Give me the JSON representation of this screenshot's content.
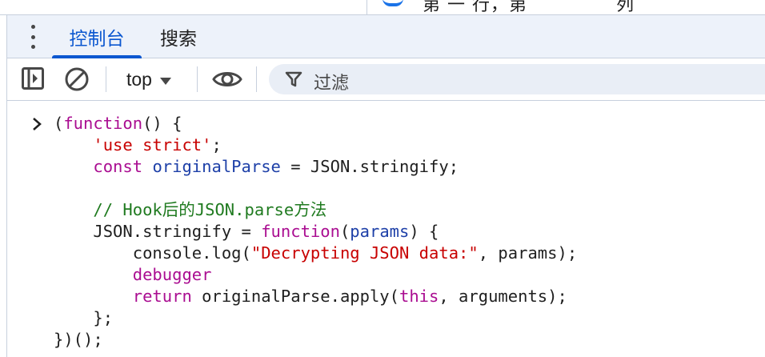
{
  "top_strip": {
    "fragment_left": "第 一 行，第",
    "fragment_right": "列"
  },
  "tabs": [
    {
      "label": "控制台",
      "active": true
    },
    {
      "label": "搜索",
      "active": false
    }
  ],
  "toolbar": {
    "context": "top",
    "filter_placeholder": "过滤"
  },
  "colors": {
    "accent": "#0b57d0",
    "tabbar_bg": "#edf2fa",
    "keyword": "#aa0d91",
    "string": "#c80000",
    "definition": "#1e40a8",
    "comment": "#1f7a1f"
  },
  "icons": [
    "more-vert-icon",
    "sidebar-toggle-icon",
    "clear-console-icon",
    "dropdown-caret-icon",
    "eye-icon",
    "filter-icon",
    "prompt-chevron-icon"
  ],
  "code": {
    "l1_open": "(",
    "l1_kw": "function",
    "l1_rest": "() {",
    "l2_str": "'use strict'",
    "l2_semi": ";",
    "l3_kw": "const",
    "l3_def": "originalParse",
    "l3_rest": " = JSON.stringify;",
    "l5_comment": "// Hook后的JSON.parse方法",
    "l6_a": "JSON.stringify = ",
    "l6_kw": "function",
    "l6_b": "(",
    "l6_def": "params",
    "l6_c": ") {",
    "l7_a": "console.log(",
    "l7_str": "\"Decrypting JSON data:\"",
    "l7_b": ", params);",
    "l8_kw": "debugger",
    "l9_kw": "return",
    "l9_a": " originalParse.apply(",
    "l9_kw2": "this",
    "l9_b": ", arguments);",
    "l10": "};",
    "l11": "})();"
  }
}
